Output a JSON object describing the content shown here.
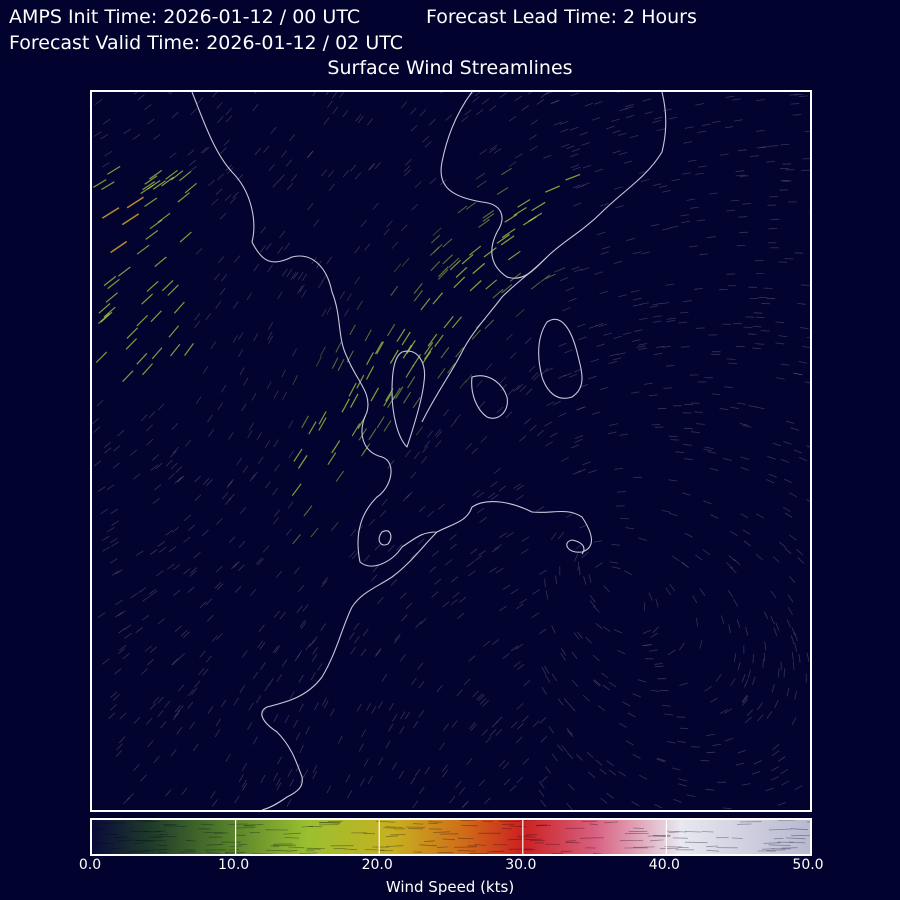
{
  "header": {
    "init_time": "AMPS Init Time: 2026-01-12 / 00 UTC",
    "lead_time": "Forecast Lead Time: 2 Hours",
    "valid_time": "Forecast Valid Time: 2026-01-12 / 02 UTC",
    "title": "Surface Wind Streamlines"
  },
  "colorbar": {
    "label": "Wind Speed (kts)",
    "ticks": [
      "0.0",
      "10.0",
      "20.0",
      "30.0",
      "40.0",
      "50.0"
    ],
    "range": [
      0,
      50
    ],
    "colors": [
      "#0a0a3a",
      "#2f5a2a",
      "#8fbf30",
      "#c8b020",
      "#d07020",
      "#d02020",
      "#e08090",
      "#e8e8f0",
      "#c0c0d8"
    ]
  },
  "colors": {
    "background": "#02022e",
    "coastline": "#c8c8d8",
    "frame": "#ffffff"
  }
}
